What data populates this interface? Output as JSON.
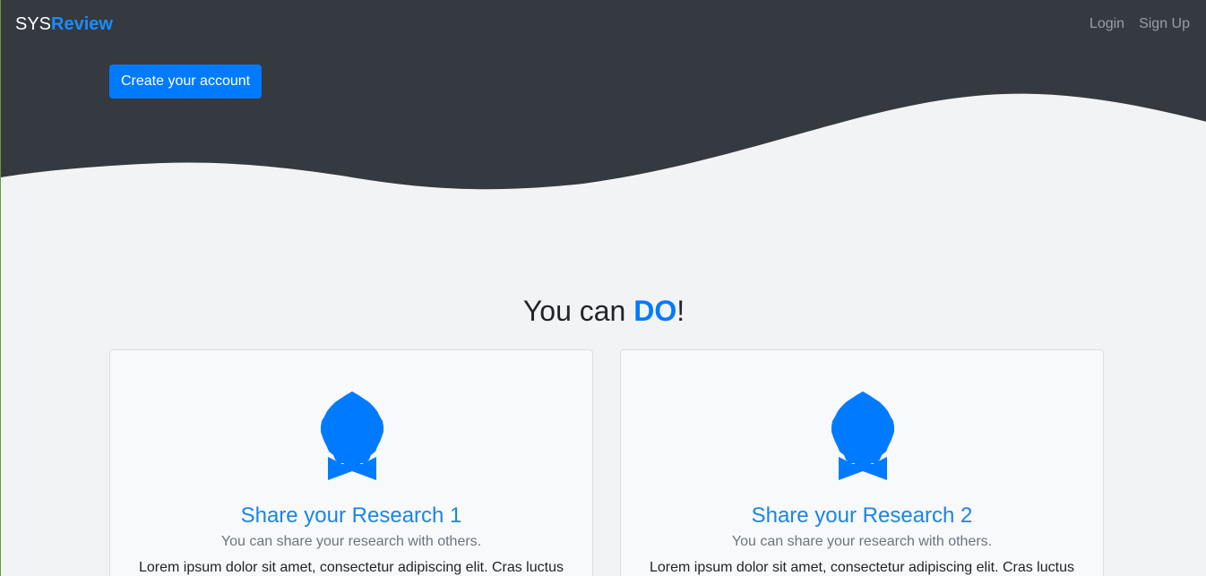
{
  "colors": {
    "hero_background": "#343a40",
    "page_background": "#f2f3f5",
    "accent": "#007bff",
    "brand_accent": "#1a8cff"
  },
  "navbar": {
    "brand_prefix": "SYS",
    "brand_accent": "Review",
    "links": [
      {
        "label": "Login"
      },
      {
        "label": "Sign Up"
      }
    ]
  },
  "hero": {
    "cta_label": "Create your account"
  },
  "section": {
    "title_prefix": "You can ",
    "title_accent": "DO",
    "title_suffix": "!"
  },
  "cards": [
    {
      "icon": "award-icon",
      "title": "Share your Research 1",
      "subtitle": "You can share your research with others.",
      "text": "Lorem ipsum dolor sit amet, consectetur adipiscing elit. Cras luctus"
    },
    {
      "icon": "award-icon",
      "title": "Share your Research 2",
      "subtitle": "You can share your research with others.",
      "text": "Lorem ipsum dolor sit amet, consectetur adipiscing elit. Cras luctus"
    }
  ]
}
